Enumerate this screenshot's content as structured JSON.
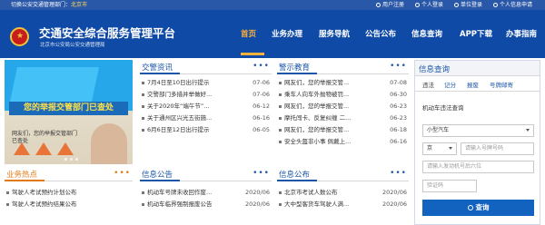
{
  "topbar": {
    "switch_label": "切换公安交通管理部门：",
    "city": "北京市",
    "links": [
      "用户注册",
      "个人登录",
      "单位登录",
      "个人信息申请"
    ]
  },
  "header": {
    "title": "交通安全综合服务管理平台",
    "subtitle": "北京市公安局公安交通管理局"
  },
  "nav": {
    "items": [
      "首页",
      "业务办理",
      "服务导航",
      "公告公布",
      "信息查询",
      "APP下载",
      "办事指南"
    ]
  },
  "banner": {
    "headline": "您的举报交管部门已查处",
    "caption": "网友们，您的举报交管部门已查处"
  },
  "news": {
    "title": "交警资讯",
    "items": [
      {
        "t": "7月4日至10日出行提示",
        "d": "07-06"
      },
      {
        "t": "交警部门多措并举做好...",
        "d": "07-06"
      },
      {
        "t": "关于2020年“端午节”...",
        "d": "06-12"
      },
      {
        "t": "关于通州区兴光五街施...",
        "d": "06-16"
      },
      {
        "t": "6月6日至12日出行提示",
        "d": "06-05"
      }
    ]
  },
  "warning": {
    "title": "警示教育",
    "items": [
      {
        "t": "网友们，您的举报交管...",
        "d": "07-08"
      },
      {
        "t": "乘车人向车外抛物被罚...",
        "d": "06-30"
      },
      {
        "t": "网友们，您的举报交管...",
        "d": "06-23"
      },
      {
        "t": "摩托闯卡、反复纠缠 二...",
        "d": "06-23"
      },
      {
        "t": "网友们，您的举报交管...",
        "d": "06-18"
      },
      {
        "t": "安全头盔非小事 佩戴上...",
        "d": "06-16"
      }
    ]
  },
  "hot": {
    "title": "业务热点",
    "items": [
      {
        "t": "驾驶人考试预约计划公布"
      },
      {
        "t": "驾驶人考试预约结果公布"
      }
    ]
  },
  "info": {
    "title": "信息公告",
    "items": [
      {
        "t": "机动车号牌未收回作废...",
        "d": "2020/06"
      },
      {
        "t": "机动车临界强制报废公告",
        "d": "2020/06"
      }
    ]
  },
  "notice": {
    "title": "信息公布",
    "items": [
      {
        "t": "北京市考试人数公布",
        "d": "2020/06"
      },
      {
        "t": "大中型客货车驾驶人满...",
        "d": "2020/06"
      }
    ]
  },
  "query": {
    "title": "信息查询",
    "tabs": [
      "违法",
      "记分",
      "报废",
      "号牌邮寄"
    ],
    "subtitle": "机动车违法查询",
    "vehicle_type": "小型汽车",
    "plate_prefix": "京",
    "plate_placeholder": "请输入号牌号码",
    "engine_placeholder": "请输入发动机号后六位",
    "captcha_placeholder": "验证码",
    "button": "查询"
  },
  "colors": {
    "brand": "#0e4aa6",
    "accent": "#ffb23a",
    "hot": "#e27a14"
  }
}
